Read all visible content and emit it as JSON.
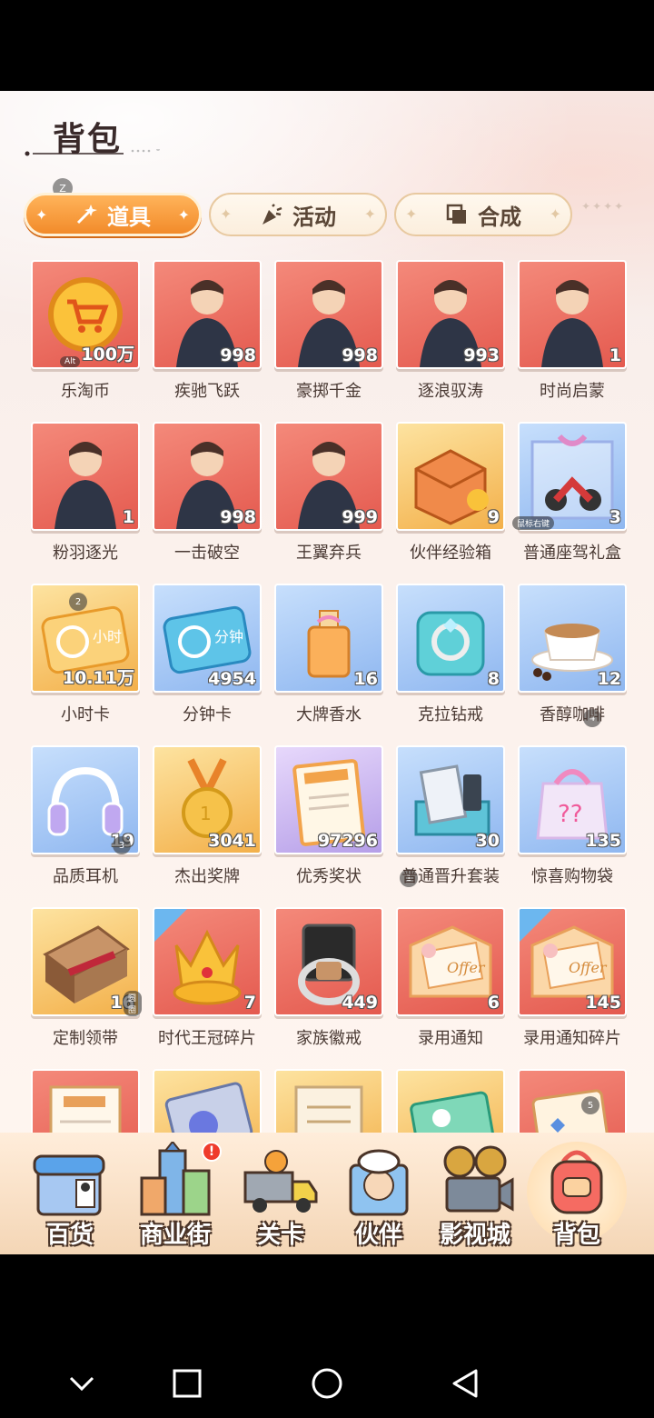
{
  "page": {
    "title": "背包"
  },
  "tabs": [
    {
      "label": "道具",
      "active": true,
      "icon": "magic-wand-icon"
    },
    {
      "label": "活动",
      "active": false,
      "icon": "party-popper-icon"
    },
    {
      "label": "合成",
      "active": false,
      "icon": "combine-icon"
    }
  ],
  "tab_badge": "Z",
  "items": [
    {
      "name": "乐淘币",
      "count": "100万",
      "bg": "red",
      "art": "shopping-cart-coin-icon",
      "tag": "Alt"
    },
    {
      "name": "疾驰飞跃",
      "count": "998",
      "bg": "red",
      "art": "rider-portrait"
    },
    {
      "name": "豪掷千金",
      "count": "998",
      "bg": "red",
      "art": "suit-man-portrait"
    },
    {
      "name": "逐浪驭涛",
      "count": "993",
      "bg": "red",
      "art": "surfer-portrait"
    },
    {
      "name": "时尚启蒙",
      "count": "1",
      "bg": "red",
      "art": "fashion-portrait"
    },
    {
      "name": "粉羽逐光",
      "count": "1",
      "bg": "red",
      "art": "angel-wings-portrait"
    },
    {
      "name": "一击破空",
      "count": "998",
      "bg": "red",
      "art": "fencer-portrait"
    },
    {
      "name": "王翼弃兵",
      "count": "999",
      "bg": "red",
      "art": "vest-man-portrait"
    },
    {
      "name": "伙伴经验箱",
      "count": "9",
      "bg": "gold",
      "art": "exp-box-icon"
    },
    {
      "name": "普通座驾礼盒",
      "count": "3",
      "bg": "blue",
      "art": "motorbike-gift-icon",
      "tag": "鼠标右键"
    },
    {
      "name": "小时卡",
      "count": "10.11万",
      "bg": "gold",
      "art": "hour-card-icon",
      "badge": "2"
    },
    {
      "name": "分钟卡",
      "count": "4954",
      "bg": "blue",
      "art": "minute-card-icon"
    },
    {
      "name": "大牌香水",
      "count": "16",
      "bg": "blue",
      "art": "perfume-icon"
    },
    {
      "name": "克拉钻戒",
      "count": "8",
      "bg": "blue",
      "art": "diamond-ring-icon"
    },
    {
      "name": "香醇咖啡",
      "count": "12",
      "bg": "blue",
      "art": "coffee-cup-icon",
      "badge": "4"
    },
    {
      "name": "品质耳机",
      "count": "19",
      "bg": "blue",
      "art": "headphones-icon",
      "badge": "3"
    },
    {
      "name": "杰出奖牌",
      "count": "3041",
      "bg": "gold",
      "art": "medal-icon"
    },
    {
      "name": "优秀奖状",
      "count": "97296",
      "bg": "purple",
      "art": "certificate-icon"
    },
    {
      "name": "普通晋升套装",
      "count": "30",
      "bg": "blue",
      "art": "keyboard-set-icon",
      "badge": "1"
    },
    {
      "name": "惊喜购物袋",
      "count": "135",
      "bg": "blue",
      "art": "surprise-bag-icon"
    },
    {
      "name": "定制领带",
      "count": "16",
      "bg": "gold",
      "art": "tie-box-icon",
      "tag": "圆圈"
    },
    {
      "name": "时代王冠碎片",
      "count": "7",
      "bg": "red",
      "art": "crown-icon",
      "fragment": true
    },
    {
      "name": "家族徽戒",
      "count": "449",
      "bg": "red",
      "art": "signet-ring-icon"
    },
    {
      "name": "录用通知",
      "count": "6",
      "bg": "red",
      "art": "offer-letter-icon"
    },
    {
      "name": "录用通知碎片",
      "count": "145",
      "bg": "red",
      "art": "offer-letter-icon",
      "fragment": true
    },
    {
      "name": "",
      "count": "",
      "bg": "red",
      "art": "paper-form-icon"
    },
    {
      "name": "",
      "count": "",
      "bg": "gold",
      "art": "ticket-icon"
    },
    {
      "name": "",
      "count": "",
      "bg": "gold",
      "art": "scroll-icon"
    },
    {
      "name": "",
      "count": "",
      "bg": "gold",
      "art": "green-ticket-icon"
    },
    {
      "name": "",
      "count": "",
      "bg": "red",
      "art": "card-icon",
      "badge": "5"
    }
  ],
  "nav": [
    {
      "label": "百货",
      "icon": "department-store-icon"
    },
    {
      "label": "商业街",
      "icon": "commercial-street-icon",
      "alert": "!"
    },
    {
      "label": "关卡",
      "icon": "truck-level-icon"
    },
    {
      "label": "伙伴",
      "icon": "partner-chef-icon"
    },
    {
      "label": "影视城",
      "icon": "film-city-icon"
    },
    {
      "label": "背包",
      "icon": "backpack-icon",
      "active": true
    }
  ],
  "system": {
    "back": "back-triangle-icon",
    "home": "home-circle-icon",
    "recents": "recents-square-icon",
    "down": "chevron-down-icon"
  }
}
